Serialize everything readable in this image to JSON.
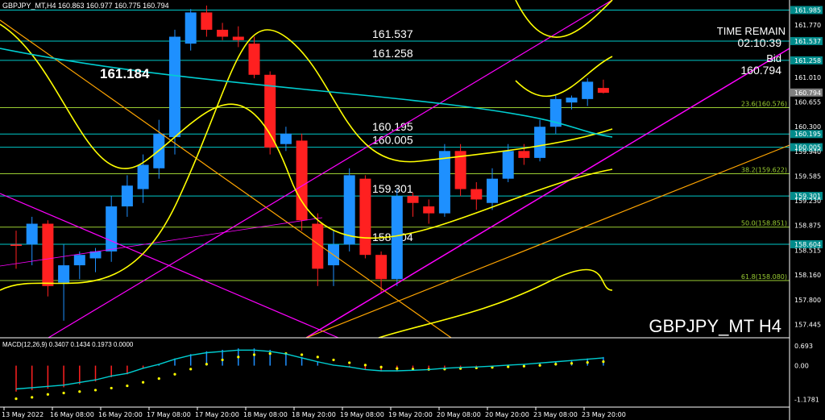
{
  "header": {
    "symbol_line": "GBPJPY_MT,H4  160.863 160.977 160.775 160.794",
    "watermark": "GBPJPY_MT H4",
    "timer_label": "TIME REMAIN",
    "timer_value": "02:10:39",
    "bid_label": "Bid",
    "bid_value": "160.794",
    "high_label": "161.184"
  },
  "colors": {
    "background": "#000000",
    "bull_candle": "#1e90ff",
    "bear_candle": "#ff2020",
    "level_line": "#00c8c8",
    "fib_line": "#9acd32",
    "trendline": "#ffa500",
    "channel": "#ff00ff",
    "bollinger": "#ffff00",
    "ma_cyan": "#00ced1",
    "macd_hist": "#1e90ff",
    "macd_signal": "#ffff00"
  },
  "chart_data": {
    "type": "candlestick",
    "symbol": "GBPJPY_MT",
    "timeframe": "H4",
    "ylim": [
      157.3,
      162.06
    ],
    "yticks": [
      "161.985",
      "161.770",
      "161.537",
      "161.258",
      "161.010",
      "160.794",
      "160.655",
      "160.300",
      "160.195",
      "160.005",
      "159.940",
      "159.585",
      "159.301",
      "159.230",
      "158.875",
      "158.604",
      "158.515",
      "158.160",
      "157.800",
      "157.445"
    ],
    "xticks": [
      "13 May 2022",
      "16 May 08:00",
      "16 May 20:00",
      "17 May 08:00",
      "17 May 20:00",
      "18 May 08:00",
      "18 May 20:00",
      "19 May 08:00",
      "19 May 20:00",
      "20 May 08:00",
      "20 May 20:00",
      "23 May 08:00",
      "23 May 20:00"
    ],
    "candles": [
      {
        "o": 158.6,
        "h": 158.8,
        "l": 158.25,
        "c": 158.58
      },
      {
        "o": 158.6,
        "h": 159.0,
        "l": 158.3,
        "c": 158.9
      },
      {
        "o": 158.9,
        "h": 158.95,
        "l": 157.85,
        "c": 158.0
      },
      {
        "o": 158.05,
        "h": 158.6,
        "l": 157.5,
        "c": 158.3
      },
      {
        "o": 158.3,
        "h": 158.5,
        "l": 158.1,
        "c": 158.45
      },
      {
        "o": 158.4,
        "h": 158.55,
        "l": 158.2,
        "c": 158.5
      },
      {
        "o": 158.5,
        "h": 159.3,
        "l": 158.35,
        "c": 159.15
      },
      {
        "o": 159.15,
        "h": 159.6,
        "l": 159.0,
        "c": 159.45
      },
      {
        "o": 159.4,
        "h": 159.9,
        "l": 159.2,
        "c": 159.75
      },
      {
        "o": 159.7,
        "h": 160.4,
        "l": 159.55,
        "c": 160.2
      },
      {
        "o": 160.15,
        "h": 161.7,
        "l": 159.9,
        "c": 161.6
      },
      {
        "o": 161.5,
        "h": 162.0,
        "l": 161.4,
        "c": 161.95
      },
      {
        "o": 161.95,
        "h": 162.05,
        "l": 161.6,
        "c": 161.7
      },
      {
        "o": 161.7,
        "h": 161.8,
        "l": 161.55,
        "c": 161.6
      },
      {
        "o": 161.6,
        "h": 161.75,
        "l": 161.45,
        "c": 161.55
      },
      {
        "o": 161.5,
        "h": 161.6,
        "l": 161.0,
        "c": 161.05
      },
      {
        "o": 161.05,
        "h": 161.1,
        "l": 159.9,
        "c": 160.0
      },
      {
        "o": 160.05,
        "h": 160.3,
        "l": 159.95,
        "c": 160.2
      },
      {
        "o": 160.1,
        "h": 160.2,
        "l": 158.8,
        "c": 158.95
      },
      {
        "o": 158.9,
        "h": 159.05,
        "l": 158.0,
        "c": 158.25
      },
      {
        "o": 158.3,
        "h": 158.8,
        "l": 158.0,
        "c": 158.6
      },
      {
        "o": 158.6,
        "h": 159.7,
        "l": 158.5,
        "c": 159.6
      },
      {
        "o": 159.55,
        "h": 159.6,
        "l": 158.4,
        "c": 158.45
      },
      {
        "o": 158.45,
        "h": 158.5,
        "l": 157.9,
        "c": 158.1
      },
      {
        "o": 158.1,
        "h": 159.4,
        "l": 158.0,
        "c": 159.3
      },
      {
        "o": 159.3,
        "h": 159.35,
        "l": 159.0,
        "c": 159.2
      },
      {
        "o": 159.15,
        "h": 159.25,
        "l": 158.9,
        "c": 159.05
      },
      {
        "o": 159.05,
        "h": 160.05,
        "l": 159.0,
        "c": 159.95
      },
      {
        "o": 159.95,
        "h": 160.05,
        "l": 159.3,
        "c": 159.4
      },
      {
        "o": 159.4,
        "h": 159.5,
        "l": 159.1,
        "c": 159.25
      },
      {
        "o": 159.2,
        "h": 159.7,
        "l": 159.1,
        "c": 159.55
      },
      {
        "o": 159.55,
        "h": 160.05,
        "l": 159.5,
        "c": 159.95
      },
      {
        "o": 159.95,
        "h": 160.05,
        "l": 159.75,
        "c": 159.85
      },
      {
        "o": 159.85,
        "h": 160.4,
        "l": 159.8,
        "c": 160.3
      },
      {
        "o": 160.3,
        "h": 160.75,
        "l": 160.2,
        "c": 160.7
      },
      {
        "o": 160.65,
        "h": 160.75,
        "l": 160.55,
        "c": 160.72
      },
      {
        "o": 160.7,
        "h": 161.0,
        "l": 160.6,
        "c": 160.95
      },
      {
        "o": 160.86,
        "h": 160.98,
        "l": 160.78,
        "c": 160.79
      }
    ],
    "levels": [
      {
        "price": 161.985,
        "label": ""
      },
      {
        "price": 161.537,
        "label": "161.537"
      },
      {
        "price": 161.258,
        "label": "161.258"
      },
      {
        "price": 160.195,
        "label": "160.195"
      },
      {
        "price": 160.005,
        "label": "160.005"
      },
      {
        "price": 159.301,
        "label": "159.301"
      },
      {
        "price": 158.604,
        "label": "158.604"
      }
    ],
    "tagged_prices": [
      "161.985",
      "161.537",
      "161.258",
      "160.794",
      "160.195",
      "160.005",
      "159.301",
      "158.604"
    ],
    "fib_levels": [
      {
        "price": 160.576,
        "label": "23.6(160.576)"
      },
      {
        "price": 159.622,
        "label": "38.2(159.622)"
      },
      {
        "price": 158.851,
        "label": "50.0(158.851)"
      },
      {
        "price": 158.08,
        "label": "61.8(158.080)"
      }
    ],
    "macd": {
      "label": "MACD(12,26,9) 0.3407 0.1434 0.1973 0.0000",
      "ylim": [
        -1.3,
        0.8
      ],
      "ticks": [
        "0.693",
        "0.00",
        "-1.1781"
      ],
      "hist": [
        -0.9,
        -0.85,
        -0.8,
        -0.75,
        -0.65,
        -0.55,
        -0.4,
        -0.3,
        -0.1,
        0.05,
        0.25,
        0.4,
        0.5,
        0.55,
        0.6,
        0.6,
        0.55,
        0.45,
        0.3,
        0.15,
        0.02,
        -0.05,
        -0.15,
        -0.2,
        -0.2,
        -0.18,
        -0.15,
        -0.1,
        -0.07,
        -0.05,
        -0.02,
        0.02,
        0.05,
        0.1,
        0.15,
        0.2,
        0.25,
        0.3
      ],
      "signal": [
        -1.15,
        -1.1,
        -1.0,
        -0.95,
        -0.9,
        -0.85,
        -0.78,
        -0.7,
        -0.58,
        -0.45,
        -0.3,
        -0.12,
        0.05,
        0.2,
        0.3,
        0.38,
        0.42,
        0.42,
        0.38,
        0.3,
        0.2,
        0.1,
        0.02,
        -0.05,
        -0.1,
        -0.12,
        -0.13,
        -0.12,
        -0.1,
        -0.08,
        -0.06,
        -0.04,
        -0.02,
        0.01,
        0.05,
        0.08,
        0.11,
        0.14
      ]
    }
  }
}
